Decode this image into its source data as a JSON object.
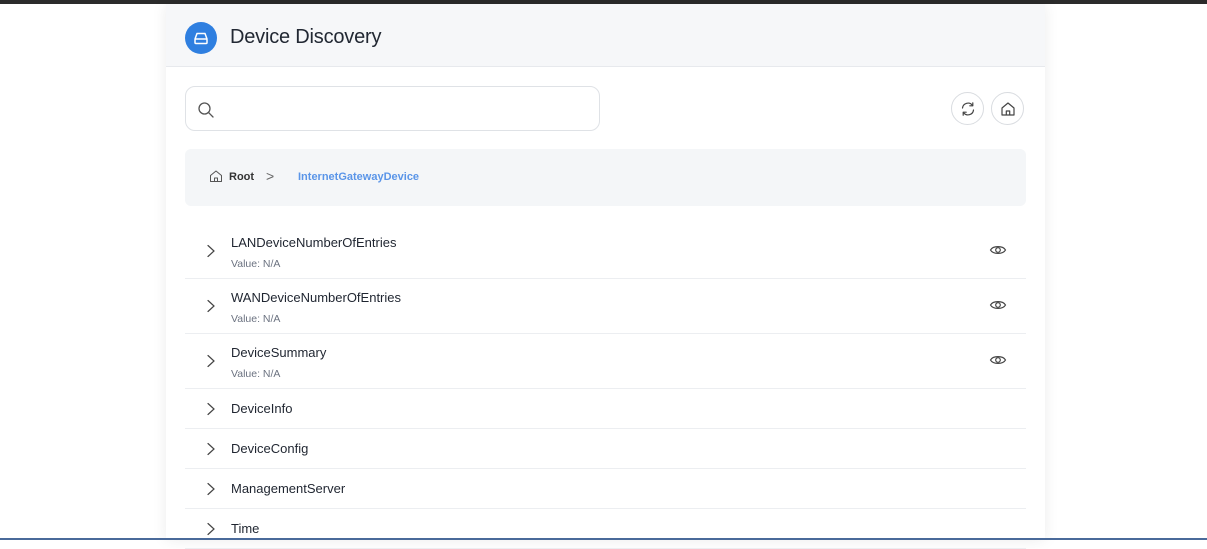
{
  "header": {
    "title": "Device Discovery",
    "logo_icon": "drive-icon"
  },
  "search": {
    "value": "",
    "placeholder": ""
  },
  "toolbar": {
    "refresh_icon": "refresh-icon",
    "home_icon": "home-icon"
  },
  "breadcrumb": {
    "root": "Root",
    "separator": ">",
    "current": "InternetGatewayDevice"
  },
  "rows": [
    {
      "name": "LANDeviceNumberOfEntries",
      "value": "Value: N/A"
    },
    {
      "name": "WANDeviceNumberOfEntries",
      "value": "Value: N/A"
    },
    {
      "name": "DeviceSummary",
      "value": "Value: N/A"
    },
    {
      "name": "DeviceInfo"
    },
    {
      "name": "DeviceConfig"
    },
    {
      "name": "ManagementServer"
    },
    {
      "name": "Time"
    }
  ],
  "colors": {
    "accent": "#2f7fe0",
    "link": "#5a95e8"
  }
}
